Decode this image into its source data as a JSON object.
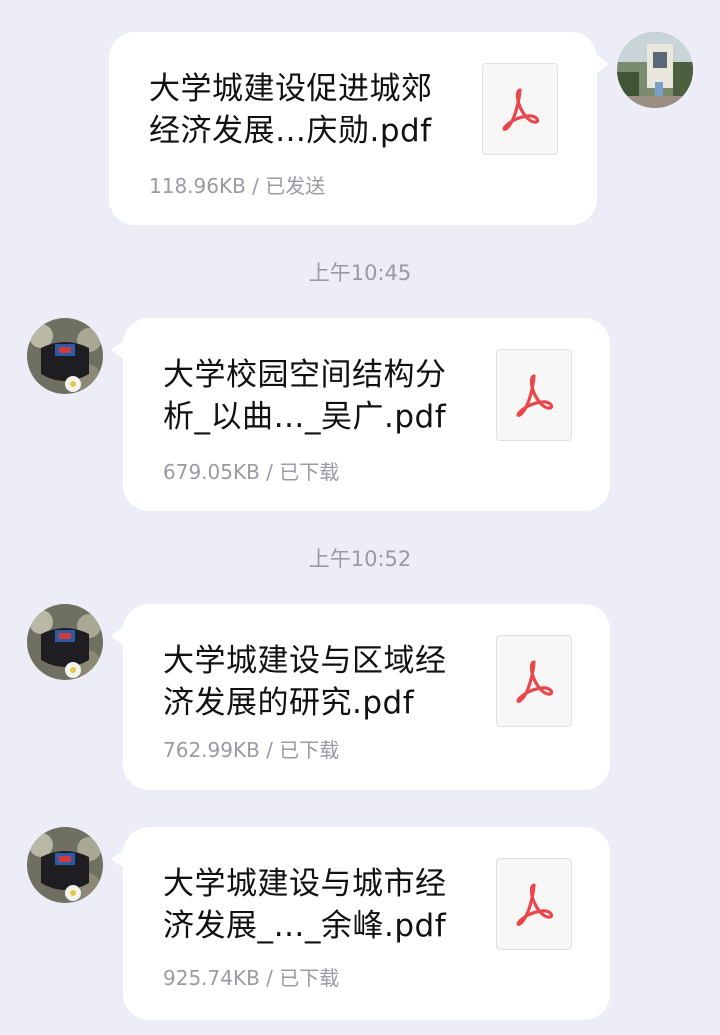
{
  "messages": [
    {
      "sender": "self",
      "file_name": "大学城建设促进城郊经济发展…庆勋.pdf",
      "file_size": "118.96KB",
      "status": "已发送",
      "icon": "pdf-icon"
    },
    {
      "sender": "contact",
      "file_name": "大学校园空间结构分析_以曲…_吴广.pdf",
      "file_size": "679.05KB",
      "status": "已下载",
      "icon": "pdf-icon"
    },
    {
      "sender": "contact",
      "file_name": "大学城建设与区域经济发展的研究.pdf",
      "file_size": "762.99KB",
      "status": "已下载",
      "icon": "pdf-icon"
    },
    {
      "sender": "contact",
      "file_name": "大学城建设与城市经济发展_…_余峰.pdf",
      "file_size": "925.74KB",
      "status": "已下载",
      "icon": "pdf-icon"
    }
  ],
  "timestamps": [
    "上午10:45",
    "上午10:52"
  ],
  "meta_separator": " / ",
  "colors": {
    "background": "#ecedf7",
    "bubble": "#ffffff",
    "pdf_red": "#e8474b",
    "meta_text": "#9a9aa3"
  }
}
